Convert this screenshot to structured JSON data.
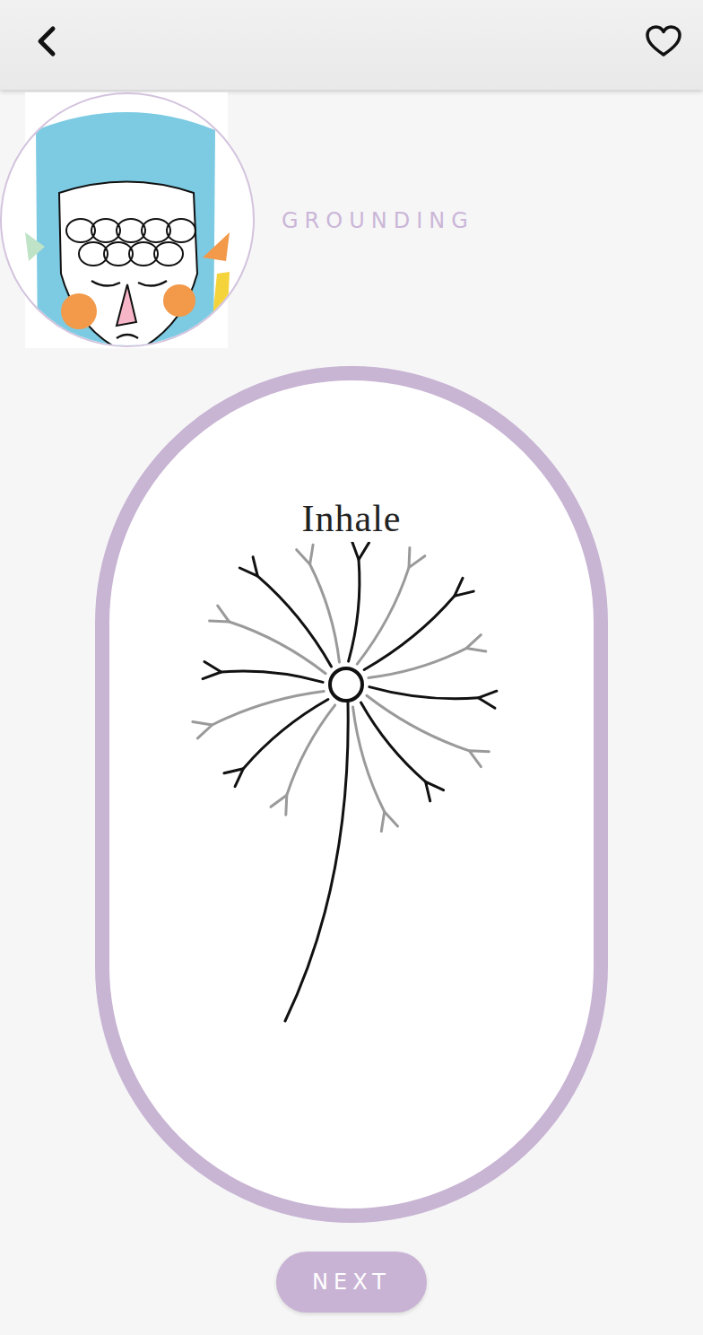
{
  "header": {
    "favorited": false
  },
  "category": "GROUNDING",
  "exercise": {
    "instruction": "Inhale"
  },
  "buttons": {
    "next": "NEXT"
  }
}
